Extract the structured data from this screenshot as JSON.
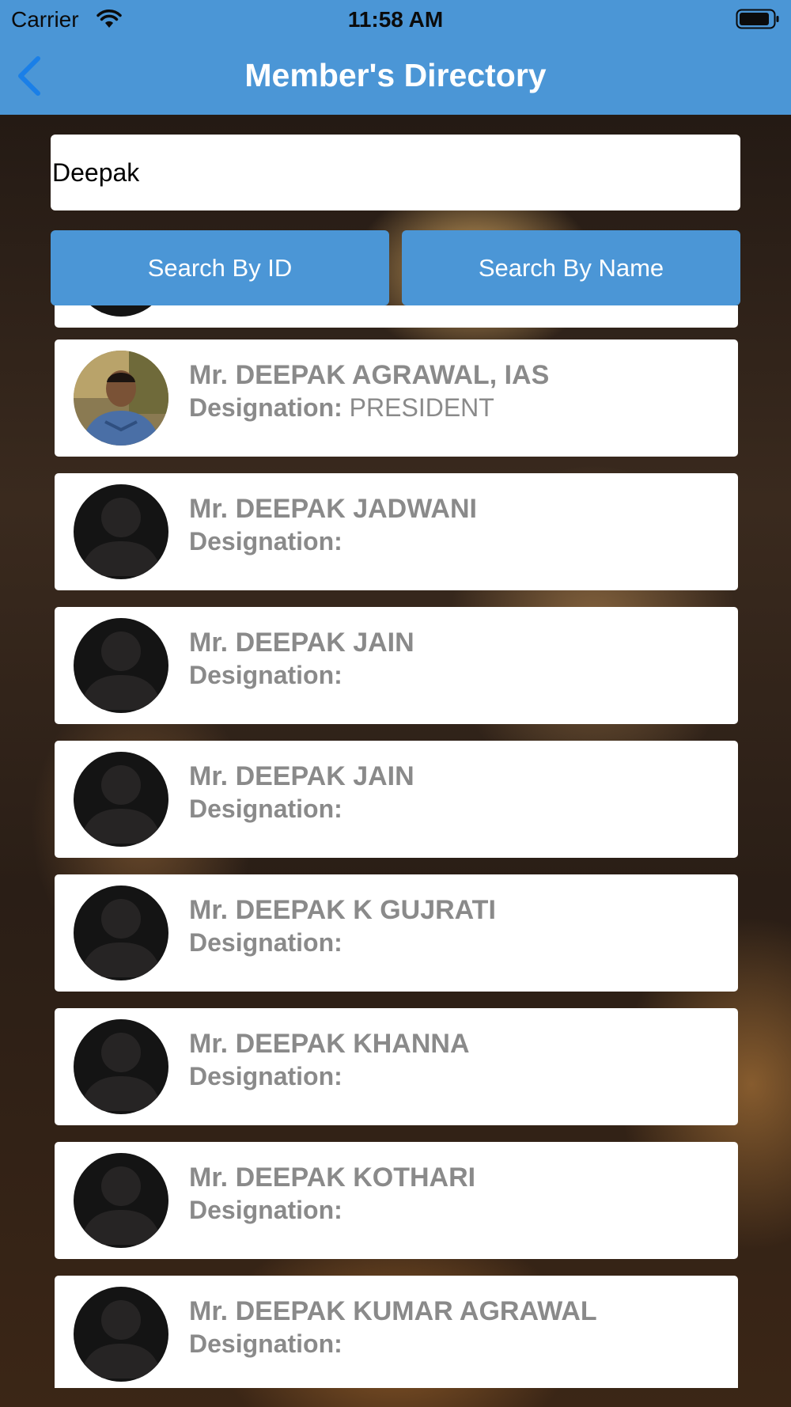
{
  "status_bar": {
    "carrier": "Carrier",
    "time": "11:58 AM"
  },
  "nav": {
    "title": "Member's Directory"
  },
  "search": {
    "value": "Deepak"
  },
  "buttons": {
    "search_by_id": "Search By ID",
    "search_by_name": "Search By Name"
  },
  "colors": {
    "accent": "#4b96d6",
    "name_text": "#8a8a8a"
  },
  "members": [
    {
      "name": "Mr. DEEPAK AGRAWAL, IAS",
      "designation_label": "Designation:",
      "designation": "PRESIDENT",
      "avatar": "photo"
    },
    {
      "name": "Mr. DEEPAK JADWANI",
      "designation_label": "Designation:",
      "designation": "",
      "avatar": "placeholder"
    },
    {
      "name": "Mr. DEEPAK JAIN",
      "designation_label": "Designation:",
      "designation": "",
      "avatar": "placeholder"
    },
    {
      "name": "Mr. DEEPAK JAIN",
      "designation_label": "Designation:",
      "designation": "",
      "avatar": "placeholder"
    },
    {
      "name": "Mr. DEEPAK K GUJRATI",
      "designation_label": "Designation:",
      "designation": "",
      "avatar": "placeholder"
    },
    {
      "name": "Mr. DEEPAK KHANNA",
      "designation_label": "Designation:",
      "designation": "",
      "avatar": "placeholder"
    },
    {
      "name": "Mr. DEEPAK KOTHARI",
      "designation_label": "Designation:",
      "designation": "",
      "avatar": "placeholder"
    },
    {
      "name": "Mr. DEEPAK KUMAR AGRAWAL",
      "designation_label": "Designation:",
      "designation": "",
      "avatar": "placeholder"
    }
  ]
}
